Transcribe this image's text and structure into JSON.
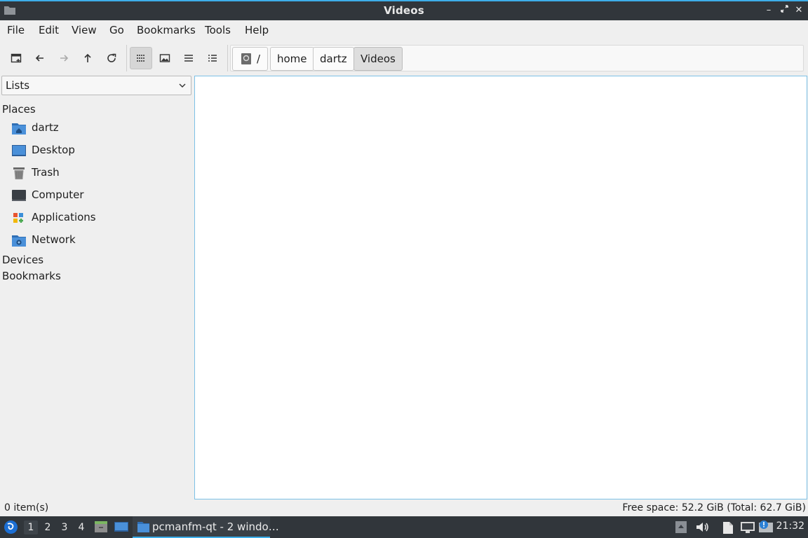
{
  "window": {
    "title": "Videos",
    "controls": {
      "minimize": "–",
      "maximize": "↗",
      "close": "✕"
    }
  },
  "menubar": [
    "File",
    "Edit",
    "View",
    "Go",
    "Bookmarks",
    "Tools",
    "Help"
  ],
  "toolbar": {
    "buttons": [
      "new-tab-icon",
      "back-icon",
      "forward-icon",
      "up-icon",
      "reload-icon",
      "icon-view-icon",
      "thumbnail-view-icon",
      "compact-view-icon",
      "detailed-list-icon"
    ],
    "active_view": "icon-view"
  },
  "pathbar": {
    "crumbs": [
      "/",
      "home",
      "dartz",
      "Videos"
    ],
    "current": "Videos"
  },
  "sidepane": {
    "mode_select": "Lists",
    "sections": [
      "Places",
      "Devices",
      "Bookmarks"
    ],
    "places": [
      {
        "label": "dartz",
        "icon": "home-folder-icon"
      },
      {
        "label": "Desktop",
        "icon": "desktop-icon"
      },
      {
        "label": "Trash",
        "icon": "trash-icon"
      },
      {
        "label": "Computer",
        "icon": "computer-icon"
      },
      {
        "label": "Applications",
        "icon": "applications-icon"
      },
      {
        "label": "Network",
        "icon": "network-folder-icon"
      }
    ]
  },
  "status": {
    "items": "0 item(s)",
    "free_space": "Free space: 52.2 GiB (Total: 62.7 GiB)"
  },
  "taskbar": {
    "desktops": [
      "1",
      "2",
      "3",
      "4"
    ],
    "active_desktop": "1",
    "task": "pcmanfm-qt - 2 windo…",
    "clock": "21:32"
  },
  "colors": {
    "accent": "#3daee9",
    "titlebar": "#31363b",
    "folder_blue": "#3b8ed8"
  }
}
